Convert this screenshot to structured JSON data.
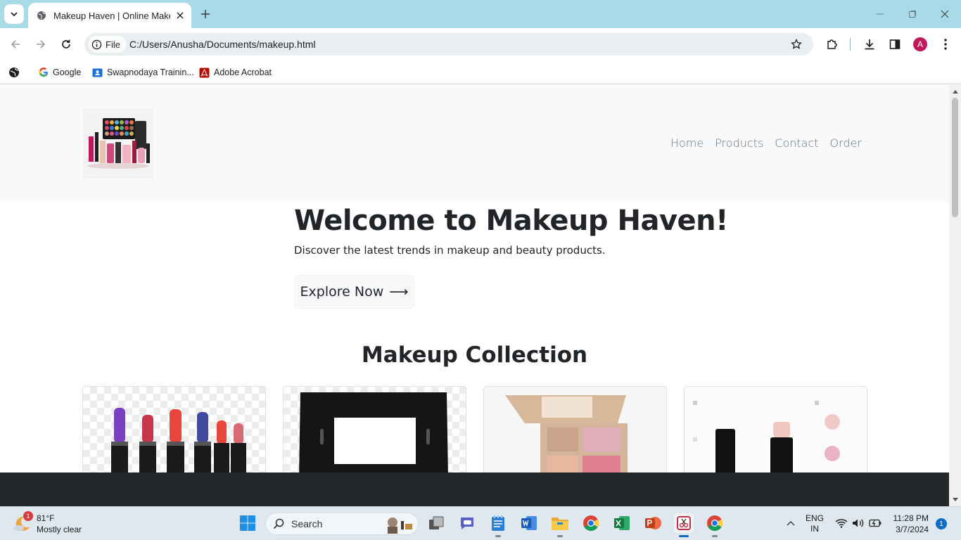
{
  "browser": {
    "tab_title": "Makeup Haven | Online Makeup",
    "site_chip_label": "File",
    "url": "C:/Users/Anusha/Documents/makeup.html",
    "profile_initial": "A",
    "bookmarks": [
      "Google",
      "Swapnodaya Trainin...",
      "Adobe Acrobat"
    ]
  },
  "site": {
    "nav": [
      "Home",
      "Products",
      "Contact",
      "Order"
    ],
    "hero_title": "Welcome to Makeup Haven!",
    "hero_subtitle": "Discover the latest trends in makeup and beauty products.",
    "cta_label": "Explore Now",
    "cta_arrow": "⟶",
    "section_title": "Makeup Collection",
    "products": [
      {
        "image": "lipstick-set-image"
      },
      {
        "image": "compact-case-image"
      },
      {
        "image": "eyeshadow-palette-image"
      },
      {
        "image": "stick-makeup-image"
      }
    ]
  },
  "taskbar": {
    "weather_temp": "81°F",
    "weather_desc": "Mostly clear",
    "weather_badge": "1",
    "search_label": "Search",
    "lang_top": "ENG",
    "lang_bottom": "IN",
    "time": "11:28 PM",
    "date": "3/7/2024",
    "notification_count": "1"
  },
  "colors": {
    "tabstrip": "#a8dbe8",
    "header_bg": "#f8f9fa",
    "nav_text": "#6c757d",
    "dark_strip": "#23282d",
    "taskbar": "#dfe8ee"
  }
}
